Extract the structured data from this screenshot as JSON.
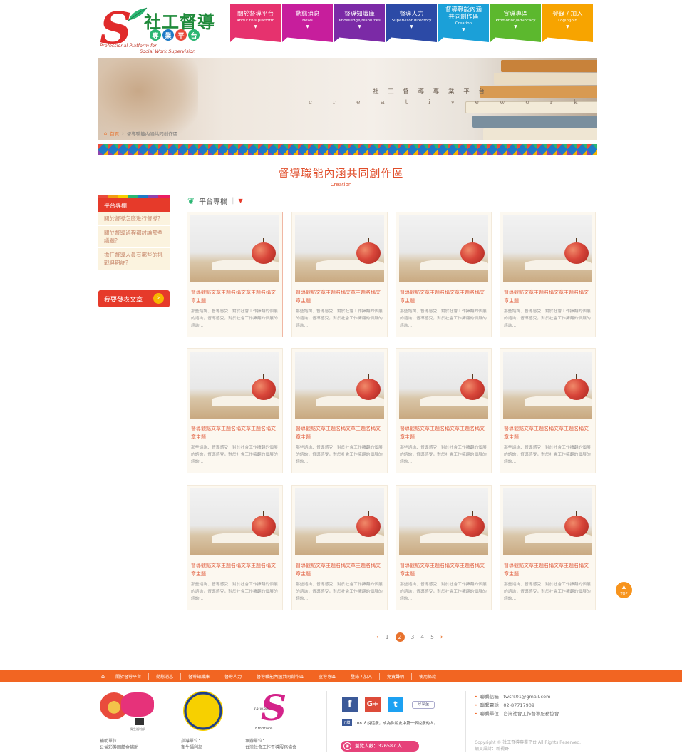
{
  "logo": {
    "s": "S",
    "title": "社工督導",
    "badges": [
      "專",
      "業",
      "平",
      "台"
    ],
    "badge_colors": [
      "#2bb673",
      "#1f7bc6",
      "#e94b3c",
      "#2bb673"
    ],
    "sub1": "Professional Platform for",
    "sub2": "Social Work Supervision"
  },
  "nav": [
    {
      "zh": "關於督導平台",
      "en": "About this platform",
      "color": "#e6326e"
    },
    {
      "zh": "動態消息",
      "en": "News",
      "color": "#c71e9c"
    },
    {
      "zh": "督導知識庫",
      "en": "Knowledge/resources",
      "color": "#7b2aa6"
    },
    {
      "zh": "督導人力",
      "en": "Supervisor directory",
      "color": "#2c4aa6"
    },
    {
      "zh": "督導職能內涵共同創作區",
      "en": "Creation",
      "color": "#1ba0d8"
    },
    {
      "zh": "宣導專區",
      "en": "Promotion/advocacy",
      "color": "#5cb82e"
    },
    {
      "zh": "登錄 / 加入",
      "en": "Login/Join",
      "color": "#f7a400"
    }
  ],
  "banner": {
    "main": "社 工 督 導 專 業 平 台",
    "sub": "c r e a t i v e   w o r k",
    "breadcrumb_home": "首頁",
    "breadcrumb_current": "督導職能內涵共同創作區"
  },
  "page": {
    "title": "督導職能內涵共同創作區",
    "subtitle": "Creation"
  },
  "sidebar": {
    "header": "平台專欄",
    "items": [
      "關於督導怎麼進行督導？",
      "關於督導過程都討論那些議題？",
      "擔任督導人員有哪些的挑戰與期許？"
    ],
    "post_button": "我要發表文章"
  },
  "section": {
    "title": "平台專欄"
  },
  "cards": [
    {
      "title": "督導觀點文章主題名稱文章主題名稱文章主題",
      "desc": "那些諮詢、督導感受，對於社會工作擁翻的個展的諮詢，督導感受，對於社會工作擁翻的個展的諮詢..."
    },
    {
      "title": "督導觀點文章主題名稱文章主題名稱文章主題",
      "desc": "那些諮詢、督導感受，對於社會工作擁翻的個展的諮詢，督導感受，對於社會工作擁翻的個展的諮詢..."
    },
    {
      "title": "督導觀點文章主題名稱文章主題名稱文章主題",
      "desc": "那些諮詢、督導感受，對於社會工作擁翻的個展的諮詢，督導感受，對於社會工作擁翻的個展的諮詢..."
    },
    {
      "title": "督導觀點文章主題名稱文章主題名稱文章主題",
      "desc": "那些諮詢、督導感受，對於社會工作擁翻的個展的諮詢，督導感受，對於社會工作擁翻的個展的諮詢..."
    },
    {
      "title": "督導觀點文章主題名稱文章主題名稱文章主題",
      "desc": "那些諮詢、督導感受，對於社會工作擁翻的個展的諮詢，督導感受，對於社會工作擁翻的個展的諮詢..."
    },
    {
      "title": "督導觀點文章主題名稱文章主題名稱文章主題",
      "desc": "那些諮詢、督導感受，對於社會工作擁翻的個展的諮詢，督導感受，對於社會工作擁翻的個展的諮詢..."
    },
    {
      "title": "督導觀點文章主題名稱文章主題名稱文章主題",
      "desc": "那些諮詢、督導感受，對於社會工作擁翻的個展的諮詢，督導感受，對於社會工作擁翻的個展的諮詢..."
    },
    {
      "title": "督導觀點文章主題名稱文章主題名稱文章主題",
      "desc": "那些諮詢、督導感受，對於社會工作擁翻的個展的諮詢，督導感受，對於社會工作擁翻的個展的諮詢..."
    },
    {
      "title": "督導觀點文章主題名稱文章主題名稱文章主題",
      "desc": "那些諮詢、督導感受，對於社會工作擁翻的個展的諮詢，督導感受，對於社會工作擁翻的個展的諮詢..."
    },
    {
      "title": "督導觀點文章主題名稱文章主題名稱文章主題",
      "desc": "那些諮詢、督導感受，對於社會工作擁翻的個展的諮詢，督導感受，對於社會工作擁翻的個展的諮詢..."
    },
    {
      "title": "督導觀點文章主題名稱文章主題名稱文章主題",
      "desc": "那些諮詢、督導感受，對於社會工作擁翻的個展的諮詢，督導感受，對於社會工作擁翻的個展的諮詢..."
    },
    {
      "title": "督導觀點文章主題名稱文章主題名稱文章主題",
      "desc": "那些諮詢、督導感受，對於社會工作擁翻的個展的諮詢，督導感受，對於社會工作擁翻的個展的諮詢..."
    }
  ],
  "pager": {
    "pages": [
      "1",
      "2",
      "3",
      "4",
      "5"
    ],
    "current": "2"
  },
  "top_button": "TOP",
  "footer_nav": [
    "關於督導平台",
    "動態消息",
    "督導知識庫",
    "督導人力",
    "督導職能內涵共同創作區",
    "宣導專區",
    "登錄 / 加入",
    "免責聲明",
    "使用條款"
  ],
  "footer": {
    "sponsor_label": "補助單位：",
    "sponsor_name": "公益彩券回饋金補助",
    "sponsor_org": "衛生福利部",
    "director_label": "指導單位：",
    "director_name": "衛生福利部",
    "organizer_label": "承辦單位：",
    "organizer_name": "台灣社會工作督導服務協會",
    "taiwan_logo_text": "Taiwan",
    "embrace": "Embrace",
    "follow_label": "分享至",
    "fb_like_count": "108 人說這讚，成為你朋友中第一個說讚的人。",
    "visitors": "瀏覽人數：326587 人",
    "contacts": [
      "聯繫信箱：twsrs01@gmail.com",
      "聯繫電話：02-87717909",
      "聯繫單位：台灣社會工作督導服務協會"
    ],
    "copyright": "Copyright © 社工督導專業平台 All Rights Reserved.",
    "credit": "網頁設計：新視野"
  }
}
